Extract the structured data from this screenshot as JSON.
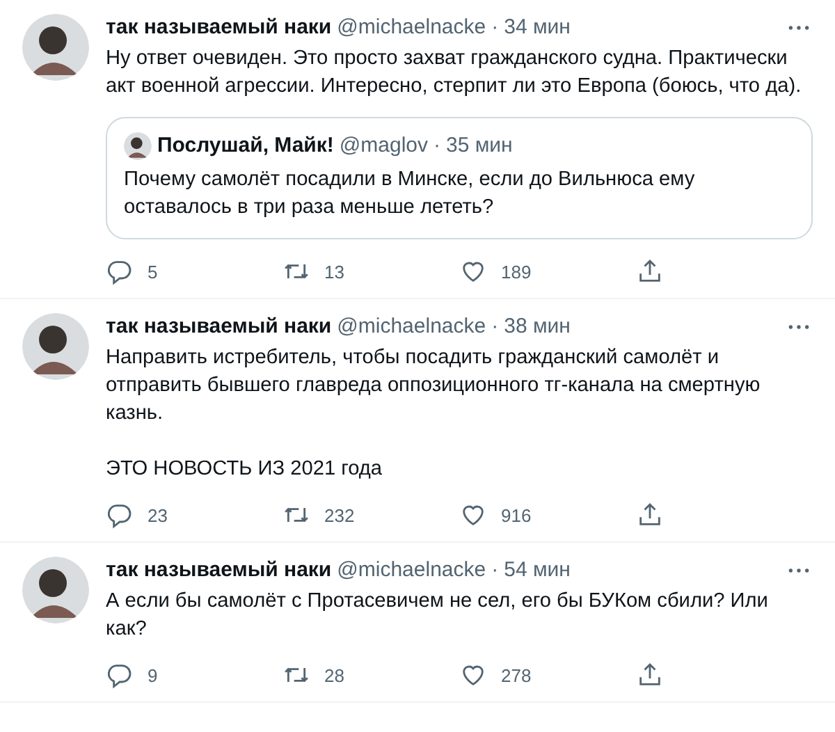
{
  "tweets": [
    {
      "name": "так называемый наки",
      "handle": "@michaelnacke",
      "dot": "·",
      "time": "34 мин",
      "paragraphs": [
        "Ну ответ очевиден. Это просто захват гражданского судна. Практически акт военной агрессии. Интересно, стерпит ли это Европа (боюсь, что да)."
      ],
      "quote": {
        "name": "Послушай, Майк!",
        "handle": "@maglov",
        "dot": "·",
        "time": "35 мин",
        "text": "Почему самолёт посадили в Минске, если до Вильнюса ему оставалось в три раза меньше лететь?"
      },
      "replies": "5",
      "retweets": "13",
      "likes": "189"
    },
    {
      "name": "так называемый наки",
      "handle": "@michaelnacke",
      "dot": "·",
      "time": "38 мин",
      "paragraphs": [
        "Направить истребитель, чтобы посадить гражданский самолёт и отправить бывшего главреда оппозиционного тг-канала на смертную казнь.",
        "ЭТО НОВОСТЬ ИЗ 2021 года"
      ],
      "replies": "23",
      "retweets": "232",
      "likes": "916"
    },
    {
      "name": "так называемый наки",
      "handle": "@michaelnacke",
      "dot": "·",
      "time": "54 мин",
      "paragraphs": [
        "А если бы самолёт с Протасевичем не сел, его бы БУКом сбили? Или как?"
      ],
      "replies": "9",
      "retweets": "28",
      "likes": "278"
    }
  ]
}
